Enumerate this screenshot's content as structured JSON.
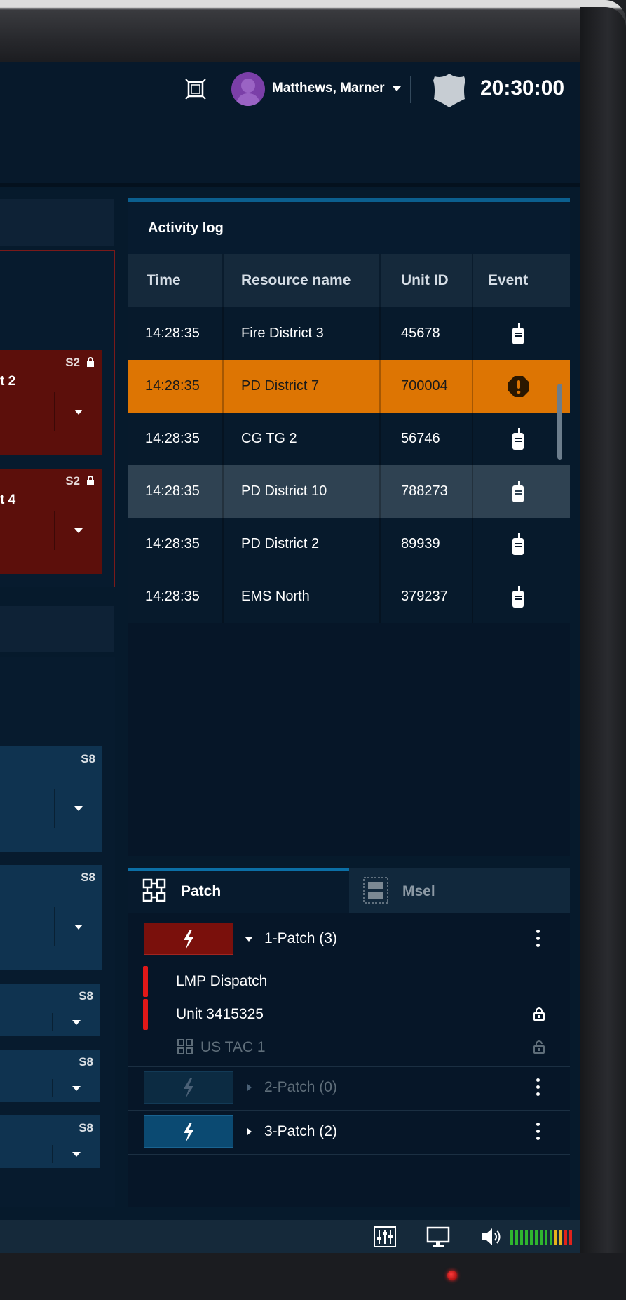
{
  "header": {
    "user_name": "Matthews, Marner",
    "clock": "20:30:00"
  },
  "left_panels": {
    "red_cards": [
      {
        "tag": "S2",
        "name_fragment": "t 2",
        "locked": true
      },
      {
        "tag": "S2",
        "name_fragment": "t 4",
        "locked": true
      }
    ],
    "blue_cards": [
      {
        "tag": "S8"
      },
      {
        "tag": "S8"
      },
      {
        "tag": "S8"
      },
      {
        "tag": "S8"
      },
      {
        "tag": "S8"
      }
    ]
  },
  "activity_log": {
    "title": "Activity log",
    "columns": [
      "Time",
      "Resource name",
      "Unit ID",
      "Event"
    ],
    "rows": [
      {
        "time": "14:28:35",
        "resource": "Fire District 3",
        "unit_id": "45678",
        "event": "radio-icon",
        "state": "normal"
      },
      {
        "time": "14:28:35",
        "resource": "PD District 7",
        "unit_id": "700004",
        "event": "alert-icon",
        "state": "alert"
      },
      {
        "time": "14:28:35",
        "resource": "CG TG 2",
        "unit_id": "56746",
        "event": "radio-icon",
        "state": "normal"
      },
      {
        "time": "14:28:35",
        "resource": "PD District 10",
        "unit_id": "788273",
        "event": "radio-icon",
        "state": "selected"
      },
      {
        "time": "14:28:35",
        "resource": "PD District 2",
        "unit_id": "89939",
        "event": "radio-icon",
        "state": "normal"
      },
      {
        "time": "14:28:35",
        "resource": "EMS North",
        "unit_id": "379237",
        "event": "radio-icon",
        "state": "normal"
      }
    ]
  },
  "patch_panel": {
    "tabs": [
      {
        "label": "Patch",
        "active": true
      },
      {
        "label": "Msel",
        "active": false
      }
    ],
    "patches": [
      {
        "label": "1-Patch (3)",
        "expanded": true,
        "members": [
          {
            "label": "LMP Dispatch",
            "lock": null
          },
          {
            "label": "Unit 3415325",
            "lock": "locked"
          },
          {
            "label": "US TAC 1",
            "lock": "unlocked",
            "disabled": true
          }
        ]
      },
      {
        "label": "2-Patch (0)",
        "expanded": false,
        "disabled": true
      },
      {
        "label": "3-Patch (2)",
        "expanded": false
      }
    ]
  },
  "status_bar": {
    "icons": [
      "mixer-icon",
      "monitor-icon",
      "speaker-icon"
    ],
    "volume_colors": [
      "#2fb52f",
      "#2fb52f",
      "#2fb52f",
      "#2fb52f",
      "#2fb52f",
      "#2fb52f",
      "#2fb52f",
      "#2fb52f",
      "#2fb52f",
      "#e8b21c",
      "#e8b21c",
      "#e0231c",
      "#e0231c"
    ]
  },
  "colors": {
    "alert_row": "#dd7503",
    "selected_row": "#2f4252",
    "patch_active_red": "#7a100c",
    "patch_blue": "#0b4a72",
    "accent": "#0b6fa6"
  }
}
